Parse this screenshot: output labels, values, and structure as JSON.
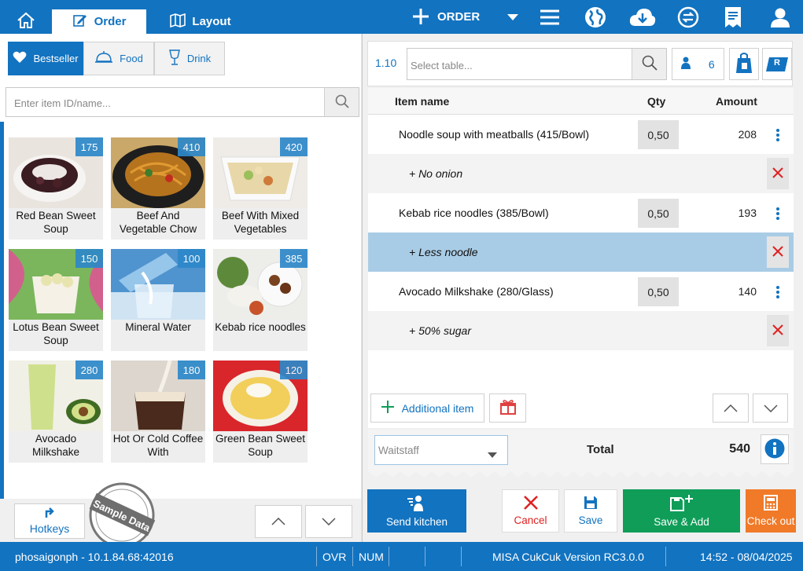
{
  "header": {
    "home_icon": "home-icon",
    "tabs": [
      {
        "label": "Order",
        "icon": "order-edit-icon",
        "active": true
      },
      {
        "label": "Layout",
        "icon": "map-icon",
        "active": false
      }
    ],
    "new_order_label": "ORDER",
    "icons": [
      "plus-icon",
      "chevron-down-icon",
      "menu-icon",
      "globe-icon",
      "cloud-download-icon",
      "sync-icon",
      "receipt-icon",
      "user-icon"
    ]
  },
  "categories": [
    {
      "label": "Bestseller",
      "icon": "heart-icon",
      "active": true
    },
    {
      "label": "Food",
      "icon": "cloche-icon",
      "active": false
    },
    {
      "label": "Drink",
      "icon": "glass-icon",
      "active": false
    }
  ],
  "item_search": {
    "placeholder": "Enter item ID/name..."
  },
  "menu_items": [
    {
      "name": "Red Bean Sweet Soup",
      "price": "175"
    },
    {
      "name": "Beef And Vegetable Chow",
      "price": "410"
    },
    {
      "name": "Beef With Mixed Vegetables",
      "price": "420"
    },
    {
      "name": "Lotus Bean Sweet Soup",
      "price": "150"
    },
    {
      "name": "Mineral Water",
      "price": "100"
    },
    {
      "name": "Kebab rice noodles",
      "price": "385"
    },
    {
      "name": "Avocado Milkshake",
      "price": "280"
    },
    {
      "name": "Hot Or Cold Coffee With",
      "price": "180"
    },
    {
      "name": "Green Bean Sweet Soup",
      "price": "120"
    }
  ],
  "left_footer": {
    "hotkeys_label": "Hotkeys",
    "sample_stamp": "Sample Data"
  },
  "order": {
    "table_no": "1.10",
    "table_placeholder": "Select table...",
    "guests": "6",
    "reserve_badge": "R",
    "columns": {
      "item": "Item name",
      "qty": "Qty",
      "amount": "Amount"
    },
    "lines": [
      {
        "type": "item",
        "name": "Noodle soup with meatballs (415/Bowl)",
        "qty": "0,50",
        "amount": "208"
      },
      {
        "type": "note",
        "name": "+ No onion"
      },
      {
        "type": "item",
        "name": "Kebab rice noodles (385/Bowl)",
        "qty": "0,50",
        "amount": "193"
      },
      {
        "type": "note",
        "name": "+ Less noodle",
        "selected": true
      },
      {
        "type": "item",
        "name": "Avocado Milkshake (280/Glass)",
        "qty": "0,50",
        "amount": "140"
      },
      {
        "type": "note",
        "name": "+ 50% sugar"
      }
    ],
    "additional_item_label": "Additional item",
    "waitstaff_placeholder": "Waitstaff",
    "total_label": "Total",
    "total_value": "540"
  },
  "actions": {
    "send_kitchen": "Send kitchen",
    "cancel": "Cancel",
    "save": "Save",
    "save_add": "Save & Add",
    "checkout": "Check out"
  },
  "colors": {
    "primary": "#1273c0",
    "cancel": "#e02020",
    "save_add": "#0f9d58",
    "checkout": "#f07a28"
  },
  "status": {
    "host": "phosaigonph - 10.1.84.68:42016",
    "ovr": "OVR",
    "num": "NUM",
    "version": "MISA CukCuk Version RC3.0.0",
    "datetime": "14:52 - 08/04/2025"
  }
}
